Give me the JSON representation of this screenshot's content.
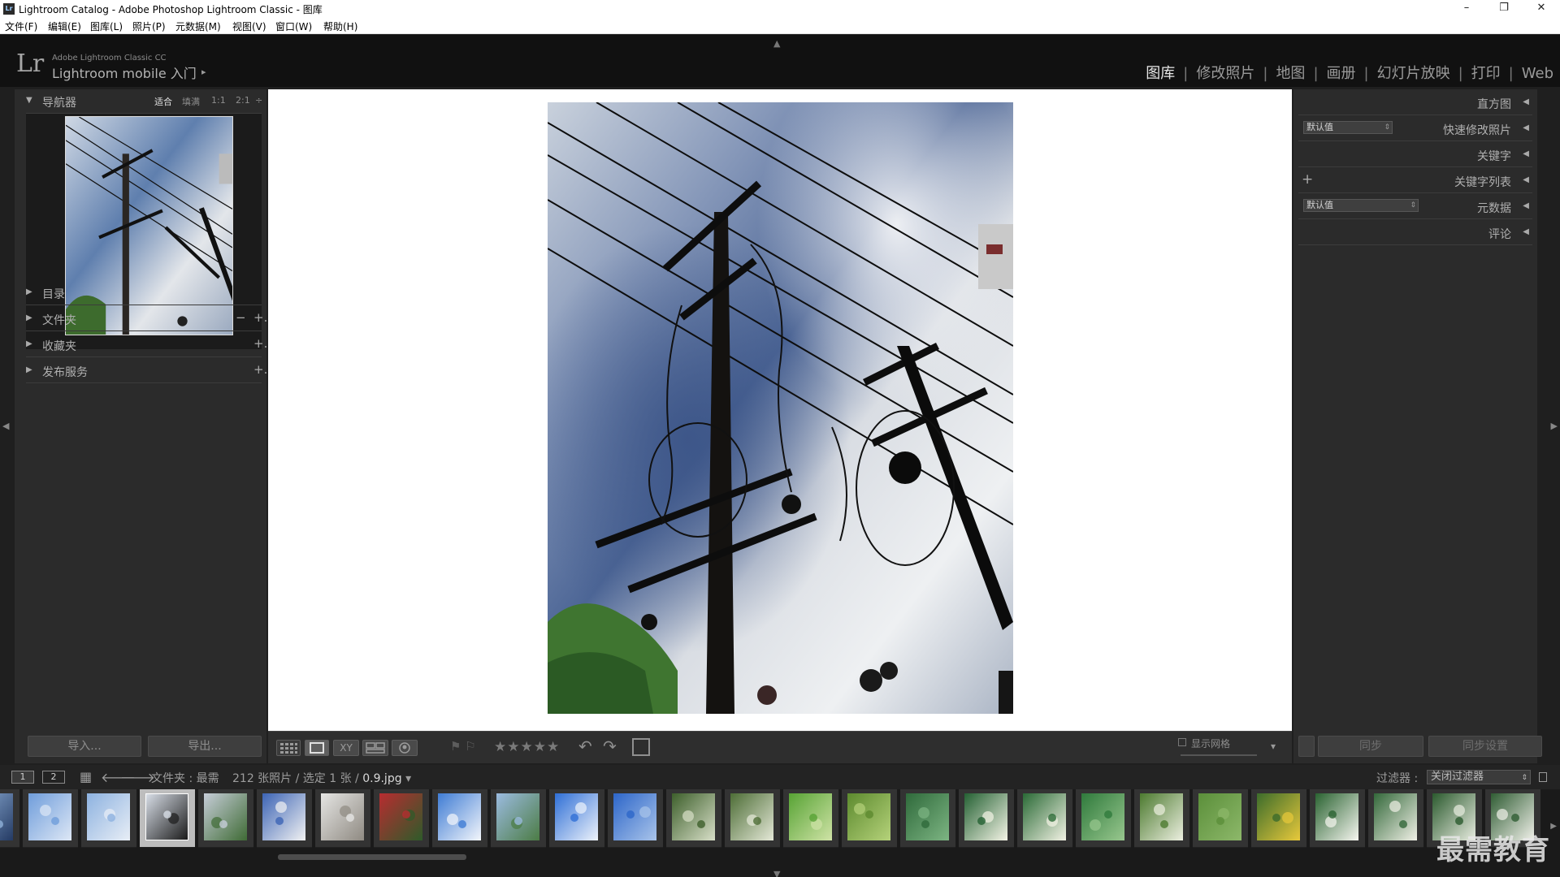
{
  "window": {
    "badge": "Lr",
    "title": "Lightroom Catalog - Adobe Photoshop Lightroom Classic - 图库",
    "controls": {
      "minimize": "–",
      "restore": "❐",
      "close": "✕"
    }
  },
  "menu": [
    "文件(F)",
    "编辑(E)",
    "图库(L)",
    "照片(P)",
    "元数据(M)",
    "视图(V)",
    "窗口(W)",
    "帮助(H)"
  ],
  "identity": {
    "logo": "Lr",
    "line1": "Adobe Lightroom Classic CC",
    "line2": "Lightroom mobile 入门",
    "arrow": "▸"
  },
  "modules": {
    "items": [
      "图库",
      "修改照片",
      "地图",
      "画册",
      "幻灯片放映",
      "打印",
      "Web"
    ],
    "active": "图库",
    "separator": "|"
  },
  "left_panel": {
    "navigator": {
      "title": "导航器",
      "zoom_options": [
        "适合",
        "填满",
        "1:1",
        "2:1"
      ],
      "zoom_active": "适合",
      "zoom_more": "÷"
    },
    "sections": [
      {
        "label": "目录",
        "minus": "",
        "plus": ""
      },
      {
        "label": "文件夹",
        "minus": "−",
        "plus": "+."
      },
      {
        "label": "收藏夹",
        "minus": "",
        "plus": "+."
      },
      {
        "label": "发布服务",
        "minus": "",
        "plus": "+."
      }
    ],
    "import_button": "导入...",
    "export_button": "导出..."
  },
  "right_panel": {
    "sections": [
      {
        "label": "直方图",
        "preset": "",
        "plus": ""
      },
      {
        "label": "快速修改照片",
        "preset": "默认值",
        "plus": ""
      },
      {
        "label": "关键字",
        "preset": "",
        "plus": ""
      },
      {
        "label": "关键字列表",
        "preset": "",
        "plus": "+"
      },
      {
        "label": "元数据",
        "preset": "默认值",
        "plus": ""
      },
      {
        "label": "评论",
        "preset": "",
        "plus": ""
      }
    ],
    "sync_button": "同步",
    "sync_settings_button": "同步设置"
  },
  "toolbar": {
    "view_modes": [
      "grid-view-icon",
      "loupe-view-icon",
      "compare-view-icon",
      "survey-view-icon",
      "people-view-icon"
    ],
    "compare_label": "XY",
    "stars": "★★★★★",
    "flags": "⚑ ⚐",
    "rotate_left": "↶",
    "rotate_right": "↷",
    "show_grid": "显示网格",
    "dropdown": "▾"
  },
  "filmstrip_header": {
    "monitor1": "1",
    "monitor2": "2",
    "source": "文件夹 : 最需",
    "count": "212 张照片 / 选定 1 张 / ",
    "filename": "0.9.jpg",
    "dropdown": "▾",
    "filter_label": "过滤器 :",
    "filter_value": "关闭过滤器"
  },
  "filmstrip": {
    "selected_index": 3,
    "thumbs": [
      "sky-wires",
      "blue-sky",
      "blue-sky-2",
      "power-pole",
      "pole-trees",
      "cloudy-sky",
      "buildings",
      "red-flowers",
      "blue-clouds",
      "green-building",
      "blue-cloud",
      "blue-sky-3",
      "white-blossom",
      "white-blossom-2",
      "green-leaf",
      "green-field",
      "green-shrub",
      "white-flower",
      "white-flower-2",
      "fern",
      "white-cluster",
      "grass",
      "yellow-flowers",
      "white-blooms",
      "white-blooms-2",
      "white-blooms-3",
      "white-blooms-4"
    ]
  },
  "watermark": "最需教育",
  "colors": {
    "accent": "#e6e6e6",
    "panel": "#2b2b2b",
    "background": "#1f1f1f"
  }
}
